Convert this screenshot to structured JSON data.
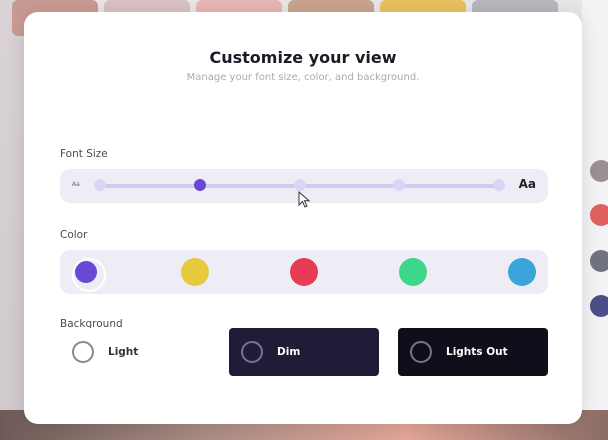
{
  "dialog": {
    "title": "Customize your view",
    "subtitle": "Manage your font size, color, and background."
  },
  "font_size": {
    "label": "Font Size",
    "small_sample": "Aa",
    "large_sample": "Aa",
    "steps": 5,
    "selected_step": 2
  },
  "color": {
    "label": "Color",
    "swatches": [
      "#6a48d6",
      "#e6c93d",
      "#e63d54",
      "#3ed68a",
      "#3aa5d8"
    ],
    "selected_index": 0
  },
  "background": {
    "label": "Background",
    "options": [
      {
        "label": "Light",
        "bg": "#ffffff"
      },
      {
        "label": "Dim",
        "bg": "#1e1c36"
      },
      {
        "label": "Lights Out",
        "bg": "#0f0e1b"
      }
    ]
  }
}
